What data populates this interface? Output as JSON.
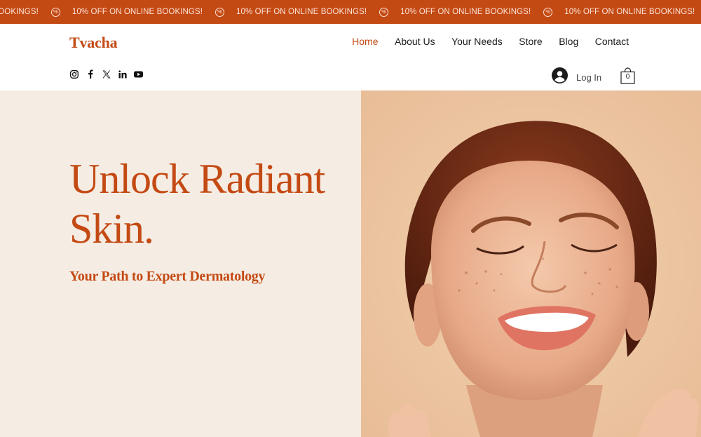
{
  "banner": {
    "messages": [
      "NE BOOKINGS!",
      "10% OFF ON ONLINE BOOKINGS!",
      "10% OFF ON ONLINE BOOKINGS!",
      "10% OFF ON ONLINE BOOKINGS!",
      "10% OFF ON ONLINE BOOKINGS!"
    ],
    "badge_symbol": "%"
  },
  "header": {
    "logo": "Tvacha",
    "nav": [
      {
        "label": "Home",
        "active": true
      },
      {
        "label": "About Us",
        "active": false
      },
      {
        "label": "Your Needs",
        "active": false
      },
      {
        "label": "Store",
        "active": false
      },
      {
        "label": "Blog",
        "active": false
      },
      {
        "label": "Contact",
        "active": false
      }
    ],
    "social_icons": [
      "instagram-icon",
      "facebook-icon",
      "x-icon",
      "linkedin-icon",
      "youtube-icon"
    ],
    "login_label": "Log In",
    "cart_count": "0"
  },
  "hero": {
    "title_line1": "Unlock Radiant",
    "title_line2": "Skin.",
    "subtitle": "Your Path to Expert Dermatology",
    "image_alt": "smiling-woman-photo"
  },
  "colors": {
    "accent": "#c44a14",
    "hero_left_bg": "#f5ede4",
    "hero_right_bg": "#eec9a8",
    "banner_text": "#fbe3d6"
  }
}
